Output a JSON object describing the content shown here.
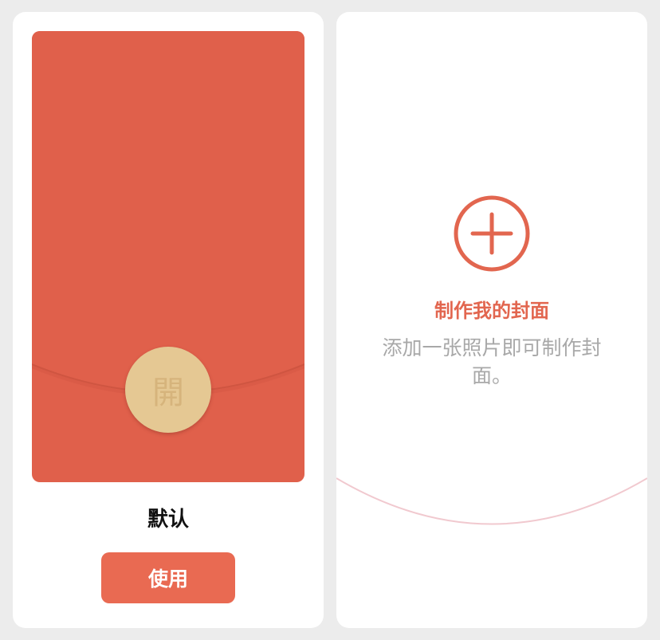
{
  "default_cover": {
    "seal_character": "開",
    "name": "默认",
    "use_button_label": "使用"
  },
  "create_cover": {
    "title": "制作我的封面",
    "hint": "添加一张照片即可制作封面。"
  },
  "colors": {
    "background": "#ececec",
    "card": "#ffffff",
    "envelope_red": "#e0604b",
    "seal_gold": "#e5c893",
    "accent": "#e96a52",
    "hint_gray": "#a8a8a8"
  },
  "icons": {
    "create": "plus-circle-icon",
    "seal": "seal-icon"
  }
}
